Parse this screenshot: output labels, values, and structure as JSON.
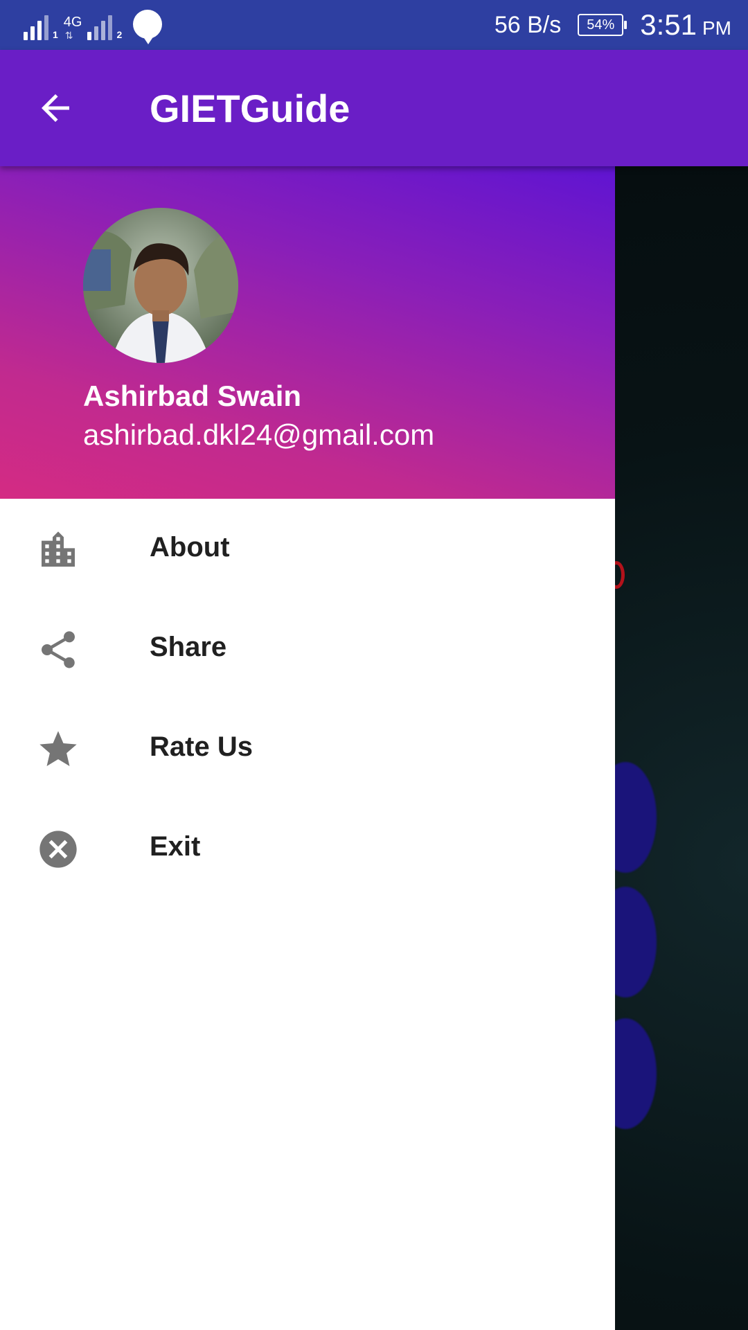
{
  "status_bar": {
    "sim1": "1",
    "network_type": "4G",
    "sim2": "2",
    "speed": "56 B/s",
    "battery": "54%",
    "time": "3:51",
    "ampm": "PM"
  },
  "app_bar": {
    "title": "GIETGuide",
    "back_icon": "arrow-back-icon"
  },
  "drawer": {
    "header": {
      "name": "Ashirbad Swain",
      "email": "ashirbad.dkl24@gmail.com"
    },
    "items": [
      {
        "label": "About",
        "icon": "building-icon"
      },
      {
        "label": "Share",
        "icon": "share-icon"
      },
      {
        "label": "Rate Us",
        "icon": "star-icon"
      },
      {
        "label": "Exit",
        "icon": "cancel-icon"
      }
    ]
  },
  "colors": {
    "status_bar": "#2e3fa1",
    "app_bar": "#6a1ec6",
    "icon_gray": "#757575"
  }
}
